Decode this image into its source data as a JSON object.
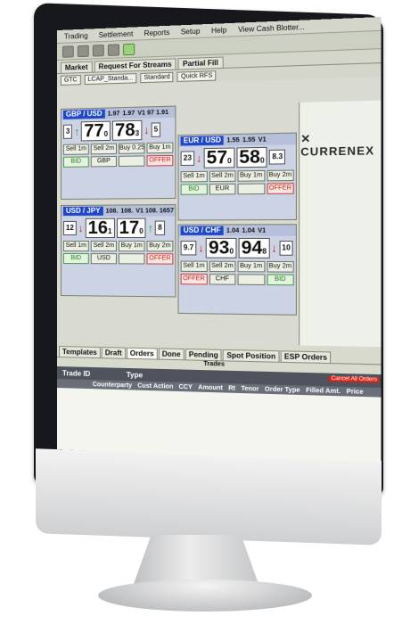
{
  "menu": [
    "Trading",
    "Settlement",
    "Reports",
    "Setup",
    "Help",
    "View Cash Blotter..."
  ],
  "tabs": {
    "market": "Market",
    "rfs": "Request For Streams",
    "partial": "Partial Fill",
    "quick": "Quick RFS"
  },
  "controls": {
    "tif": "GTC",
    "account": "LCAP_Standa...",
    "template": "Standard"
  },
  "panels": [
    {
      "pair": "GBP / USD",
      "bid_hdr": "1.97",
      "offer_hdr": "1.97",
      "extra": "V1 97 1.91",
      "left_small": "3",
      "bid_big": "77",
      "bid_sup": "0",
      "offer_big": "78",
      "offer_sup": "3",
      "right_small": "5",
      "buttons1": [
        "Sell 1m",
        "Sell 2m",
        "Buy 0.25m",
        "Buy 1m"
      ],
      "buttons2": [
        "BID",
        "GBP",
        "",
        "OFFER"
      ]
    },
    {
      "pair": "USD / JPY",
      "bid_hdr": "108.",
      "offer_hdr": "108.",
      "extra": "V1 108. 1657",
      "left_small": "12",
      "bid_big": "16",
      "bid_sup": "1",
      "offer_big": "17",
      "offer_sup": "0",
      "right_small": "8",
      "buttons1": [
        "Sell 1m",
        "Sell 2m",
        "Buy 1m",
        "Buy 2m"
      ],
      "buttons2": [
        "BID",
        "USD",
        "",
        "OFFER"
      ]
    },
    {
      "pair": "EUR / USD",
      "bid_hdr": "1.55",
      "offer_hdr": "1.55",
      "extra": "V1",
      "left_small": "23",
      "bid_big": "57",
      "bid_sup": "0",
      "offer_big": "58",
      "offer_sup": "0",
      "right_small": "8.3",
      "buttons1": [
        "Sell 1m",
        "Sell 2m",
        "Buy 1m",
        "Buy 2m"
      ],
      "buttons2": [
        "BID",
        "EUR",
        "",
        "OFFER"
      ]
    },
    {
      "pair": "USD / CHF",
      "bid_hdr": "1.04",
      "offer_hdr": "1.04",
      "extra": "V1",
      "left_small": "9.7",
      "bid_big": "93",
      "bid_sup": "0",
      "offer_big": "94",
      "offer_sup": "8",
      "right_small": "10",
      "buttons1": [
        "Sell 1m",
        "Sell 2m",
        "Buy 1m",
        "Buy 2m"
      ],
      "buttons2": [
        "OFFER",
        "CHF",
        "",
        "BID"
      ]
    }
  ],
  "logo": "CURRENEX",
  "lower": {
    "tabs": [
      "Templates",
      "Draft",
      "Orders",
      "Done",
      "Pending",
      "Spot Position",
      "ESP Orders"
    ],
    "trades_label": "Trades",
    "header1": [
      "Trade ID",
      "Type"
    ],
    "header2": [
      "Counterparty",
      "Cust Action",
      "CCY",
      "Amount",
      "Rt",
      "Tenor",
      "Order Type",
      "Filled Amt.",
      "Price"
    ],
    "red_button": "Cancel All Orders"
  },
  "colors": {
    "ccy_blue": "#1f48c9",
    "bid_green": "#1b7a1b",
    "offer_red": "#c21"
  }
}
